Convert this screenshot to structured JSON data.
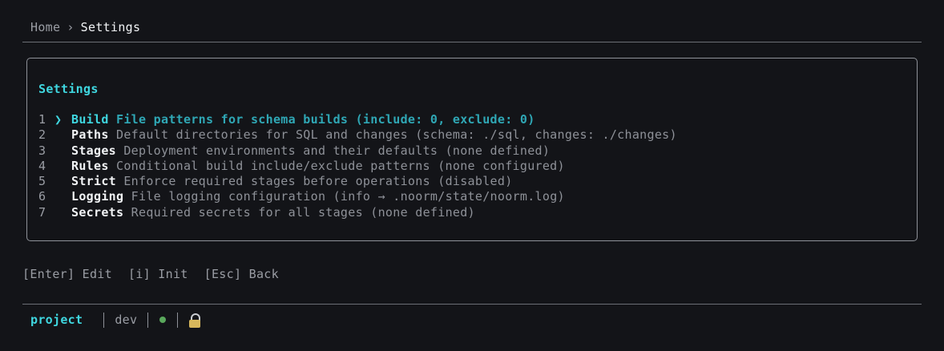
{
  "breadcrumb": {
    "home": "Home",
    "separator": "›",
    "current": "Settings"
  },
  "panel": {
    "title": "Settings",
    "cursor_glyph": "❯",
    "items": [
      {
        "number": "1",
        "name": "Build",
        "description": "File patterns for schema builds (include: 0, exclude: 0)",
        "selected": true
      },
      {
        "number": "2",
        "name": "Paths",
        "description": "Default directories for SQL and changes (schema: ./sql, changes: ./changes)",
        "selected": false
      },
      {
        "number": "3",
        "name": "Stages",
        "description": "Deployment environments and their defaults (none defined)",
        "selected": false
      },
      {
        "number": "4",
        "name": "Rules",
        "description": "Conditional build include/exclude patterns (none configured)",
        "selected": false
      },
      {
        "number": "5",
        "name": "Strict",
        "description": "Enforce required stages before operations (disabled)",
        "selected": false
      },
      {
        "number": "6",
        "name": "Logging",
        "description": "File logging configuration (info → .noorm/state/noorm.log)",
        "selected": false
      },
      {
        "number": "7",
        "name": "Secrets",
        "description": "Required secrets for all stages (none defined)",
        "selected": false
      }
    ]
  },
  "hints": {
    "edit": "[Enter] Edit",
    "init": "[i] Init",
    "back": "[Esc] Back"
  },
  "status": {
    "project": "project",
    "stage": "dev",
    "connection_icon": "status-dot-icon",
    "lock_icon": "lock-icon"
  },
  "colors": {
    "background": "#131418",
    "accent": "#3fd6df",
    "accent_dim": "#2fa7b5",
    "muted": "#8e9198",
    "status_ok": "#5aa85c"
  }
}
